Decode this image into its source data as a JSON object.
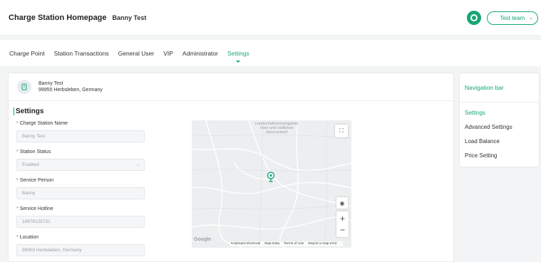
{
  "header": {
    "title": "Charge Station Homepage",
    "subtitle": "Banny Test",
    "team_select": "Test team"
  },
  "tabs": [
    {
      "label": "Charge Point",
      "active": false
    },
    {
      "label": "Station Transactions",
      "active": false
    },
    {
      "label": "General User",
      "active": false
    },
    {
      "label": "VIP",
      "active": false
    },
    {
      "label": "Administrator",
      "active": false
    },
    {
      "label": "Settings",
      "active": true
    }
  ],
  "station": {
    "name": "Banny Test",
    "address": "99955 Herbsleben, Germany"
  },
  "settings": {
    "section_title": "Settings",
    "fields": {
      "station_name": {
        "label": "Charge Station Name",
        "value": "Banny Test",
        "required": true
      },
      "station_status": {
        "label": "Station Status",
        "value": "Enabled",
        "required": true
      },
      "service_person": {
        "label": "Service Person",
        "value": "Banny",
        "required": true
      },
      "service_hotline": {
        "label": "Service Hotline",
        "value": "19876125731",
        "required": true
      },
      "location": {
        "label": "Location",
        "value": "99955 Herbsleben, Germany",
        "required": true
      }
    }
  },
  "map": {
    "region_label_1": "Landschaftsschutzgebiet",
    "region_label_2": "Harz und südliches",
    "region_label_3": "Harzvorland",
    "google_logo": "Google",
    "footer": {
      "shortcuts": "Keyboard shortcuts",
      "map_data": "Map Data",
      "terms": "Terms of Use",
      "report": "Report a map error"
    },
    "zoom_in": "+",
    "zoom_out": "−"
  },
  "navigation": {
    "title": "Navigation bar",
    "items": [
      {
        "label": "Settings",
        "active": true
      },
      {
        "label": "Advanced Settings",
        "active": false
      },
      {
        "label": "Load Balance",
        "active": false
      },
      {
        "label": "Price Setting",
        "active": false
      }
    ]
  },
  "colors": {
    "accent": "#17a673",
    "required": "#e24c4c"
  }
}
